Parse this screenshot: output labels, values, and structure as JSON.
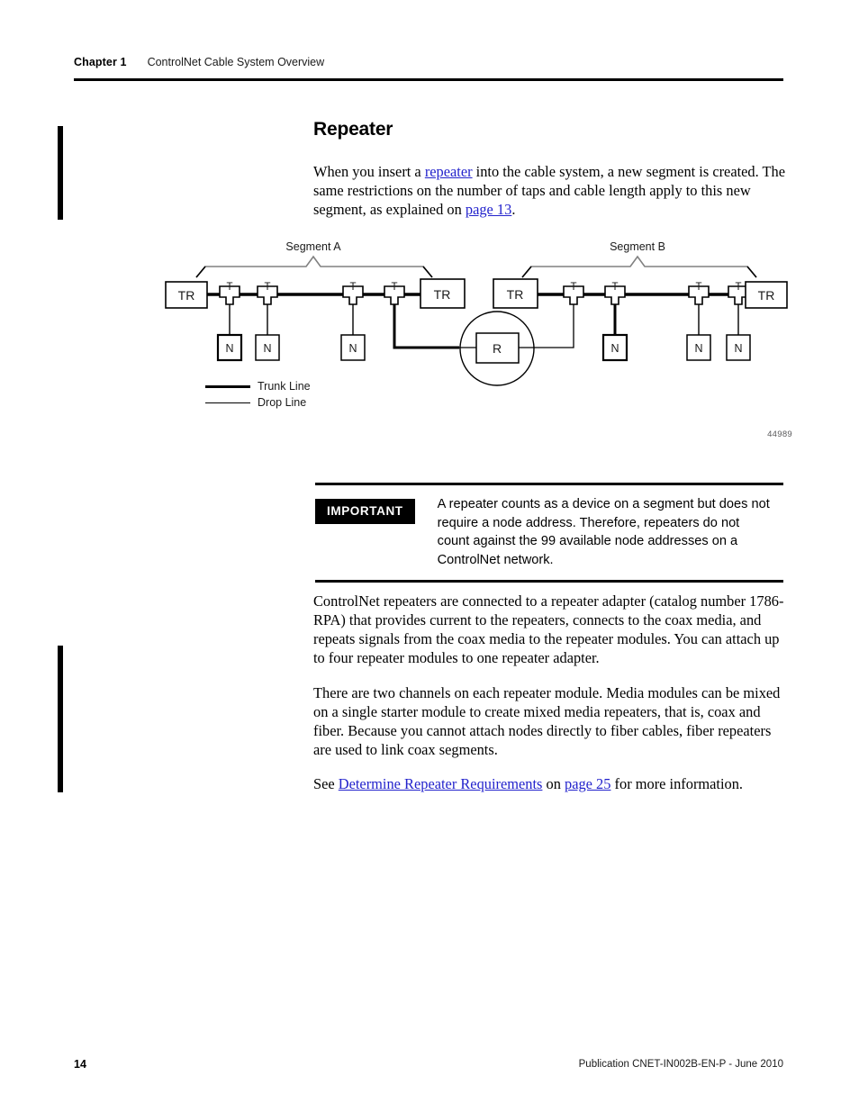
{
  "header": {
    "chapter": "Chapter 1",
    "title": "ControlNet Cable System Overview"
  },
  "section": {
    "heading": "Repeater",
    "intro": {
      "part1": "When you insert a ",
      "link1": "repeater",
      "part2": " into the cable system, a new segment is created. The same restrictions on the number of taps and cable length apply to this new segment, as explained on ",
      "link2": "page 13",
      "part3": "."
    }
  },
  "figure": {
    "figure_number": "44989",
    "segment_a_label": "Segment A",
    "segment_b_label": "Segment B",
    "terminator_label": "TR",
    "tap_label": "T",
    "node_label": "N",
    "repeater_label": "R",
    "legend": [
      {
        "name": "trunk-line",
        "label": "Trunk Line"
      },
      {
        "name": "drop-line",
        "label": "Drop Line"
      }
    ],
    "segment_a": {
      "terminators": 2,
      "taps": 4,
      "nodes": 3
    },
    "segment_b": {
      "terminators": 2,
      "taps": 4,
      "nodes": 3
    }
  },
  "callout": {
    "tag": "IMPORTANT",
    "text": "A repeater counts as a device on a segment but does not require a node address. Therefore, repeaters do not count against the 99 available node addresses on a ControlNet network."
  },
  "body": {
    "paragraph2": "ControlNet repeaters are connected to a repeater adapter (catalog number 1786-RPA) that provides current to the repeaters, connects to the coax media, and repeats signals from the coax media to the repeater modules. You can attach up to four repeater modules to one repeater adapter.",
    "paragraph3": "There are two channels on each repeater module. Media modules can be mixed on a single starter module to create mixed media repeaters, that is, coax and fiber. Because you cannot attach nodes directly to fiber cables, fiber repeaters are used to link coax segments.",
    "paragraph4": {
      "part1": "See ",
      "link1": "Determine Repeater Requirements",
      "part2": " on ",
      "link2": "page 25",
      "part3": " for more information."
    }
  },
  "footer": {
    "page_number": "14",
    "publication": "Publication CNET-IN002B-EN-P - June 2010"
  },
  "colors": {
    "link": "#2222cc",
    "rule": "#000000",
    "figure_number": "#58585a"
  }
}
